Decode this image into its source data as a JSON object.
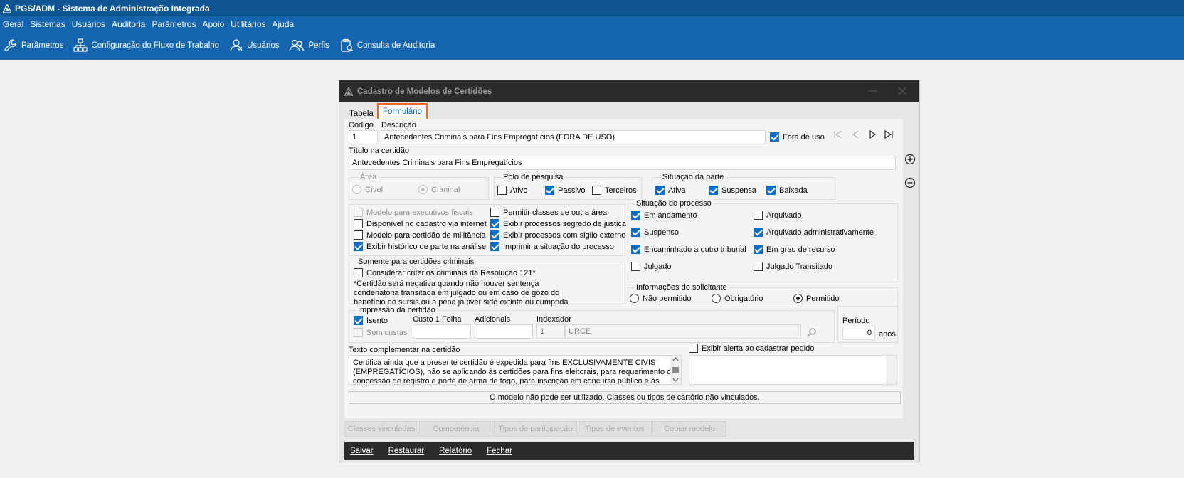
{
  "app": {
    "title": "PGS/ADM - Sistema de Administração Integrada",
    "menu": [
      "Geral",
      "Sistemas",
      "Usuários",
      "Auditoria",
      "Parâmetros",
      "Apoio",
      "Utilitários",
      "Ajuda"
    ],
    "toolbar": [
      {
        "label": "Parâmetros",
        "icon": "wrench-icon"
      },
      {
        "label": "Configuração do Fluxo de Trabalho",
        "icon": "org-chart-icon"
      },
      {
        "label": "Usuários",
        "icon": "user-icon"
      },
      {
        "label": "Perfis",
        "icon": "users-icon"
      },
      {
        "label": "Consulta de Auditoria",
        "icon": "clipboard-icon"
      }
    ],
    "colors": {
      "titlebar": "#0e5592",
      "menubar": "#1565ae",
      "accent": "#0b6fc9",
      "highlight": "#f26522"
    }
  },
  "dialog": {
    "title": "Cadastro de Modelos de Certidões",
    "tabs": {
      "tabela": "Tabela",
      "formulario": "Formulário"
    },
    "codigo": {
      "label": "Código",
      "value": "1"
    },
    "descricao": {
      "label": "Descrição",
      "value": "Antecedentes Criminais para Fins Empregatícios (FORA DE USO)"
    },
    "fora_de_uso": {
      "label": "Fora de uso",
      "checked": true
    },
    "titulo": {
      "label": "Título na certidão",
      "value": "Antecedentes Criminais para Fins Empregatícios"
    },
    "area": {
      "label": "Área",
      "civel": "Cível",
      "criminal": "Criminal"
    },
    "polo": {
      "label": "Polo de pesquisa",
      "ativo": "Ativo",
      "passivo": "Passivo",
      "terceiros": "Terceiros"
    },
    "situacao_parte": {
      "label": "Situação da parte",
      "ativa": "Ativa",
      "suspensa": "Suspensa",
      "baixada": "Baixada"
    },
    "options_left": [
      {
        "label": "Modelo para executivos fiscais",
        "checked": false,
        "disabled": true
      },
      {
        "label": "Disponível no cadastro via internet",
        "checked": false
      },
      {
        "label": "Modelo para certidão de militância",
        "checked": false
      },
      {
        "label": "Exibir histórico de parte na análise",
        "checked": true
      }
    ],
    "options_mid": [
      {
        "label": "Permitir classes de outra área",
        "checked": false
      },
      {
        "label": "Exibir processos segredo de justiça",
        "checked": true
      },
      {
        "label": "Exibir processos com sigilo externo",
        "checked": true
      },
      {
        "label": "Imprimir a situação do processo",
        "checked": true
      }
    ],
    "situacao_processo": {
      "label": "Situação do processo",
      "items": [
        {
          "label": "Em andamento",
          "checked": true
        },
        {
          "label": "Arquivado",
          "checked": false
        },
        {
          "label": "Suspenso",
          "checked": true
        },
        {
          "label": "Arquivado administrativamente",
          "checked": true
        },
        {
          "label": "Encaminhado a outro tribunal",
          "checked": true
        },
        {
          "label": "Em grau de recurso",
          "checked": true
        },
        {
          "label": "Julgado",
          "checked": false
        },
        {
          "label": "Julgado Transitado",
          "checked": false
        }
      ]
    },
    "criminais": {
      "label": "Somente para certidões criminais",
      "check": "Considerar critérios criminais da Resolução 121*",
      "note": [
        "*Certidão será negativa quando não houver sentença",
        "condenatória transitada em julgado ou em caso de gozo do",
        "benefício do sursis ou a pena já tiver sido extinta ou cumprida"
      ]
    },
    "solicitante": {
      "label": "Informações do solicitante",
      "nao": "Não permitido",
      "obrigatorio": "Obrigatório",
      "permitido": "Permitido"
    },
    "impressao": {
      "label": "Impressão da certidão",
      "isento": "Isento",
      "sem_custas": "Sem custas",
      "custo_label": "Custo 1 Folha",
      "adicionais_label": "Adicionais",
      "indexador_label": "Indexador",
      "indexador_code": "1",
      "indexador_name": "URCE"
    },
    "periodo": {
      "label": "Período",
      "value": "0",
      "unit": "anos"
    },
    "texto": {
      "label": "Texto complementar na certidão",
      "lines": [
        "Certifica ainda que a presente certidão é expedida para fins EXCLUSIVAMENTE CIVIS",
        "(EMPREGATÍCIOS), não se aplicando às certidões para fins eleitorais, para requerimento de",
        "concessão de registro e porte de arma de fogo, para inscrição em concurso público e às"
      ]
    },
    "alerta": {
      "label": "Exibir alerta ao cadastrar pedido"
    },
    "message": "O modelo não pode ser utilizado. Classes ou tipos de cartório não vinculados.",
    "subtabs": [
      "Classes vinculadas",
      "Competência",
      "Tipos de participação",
      "Tipos de eventos",
      "Copiar modelo"
    ],
    "actions": [
      "Salvar",
      "Restaurar",
      "Relatório",
      "Fechar"
    ]
  }
}
